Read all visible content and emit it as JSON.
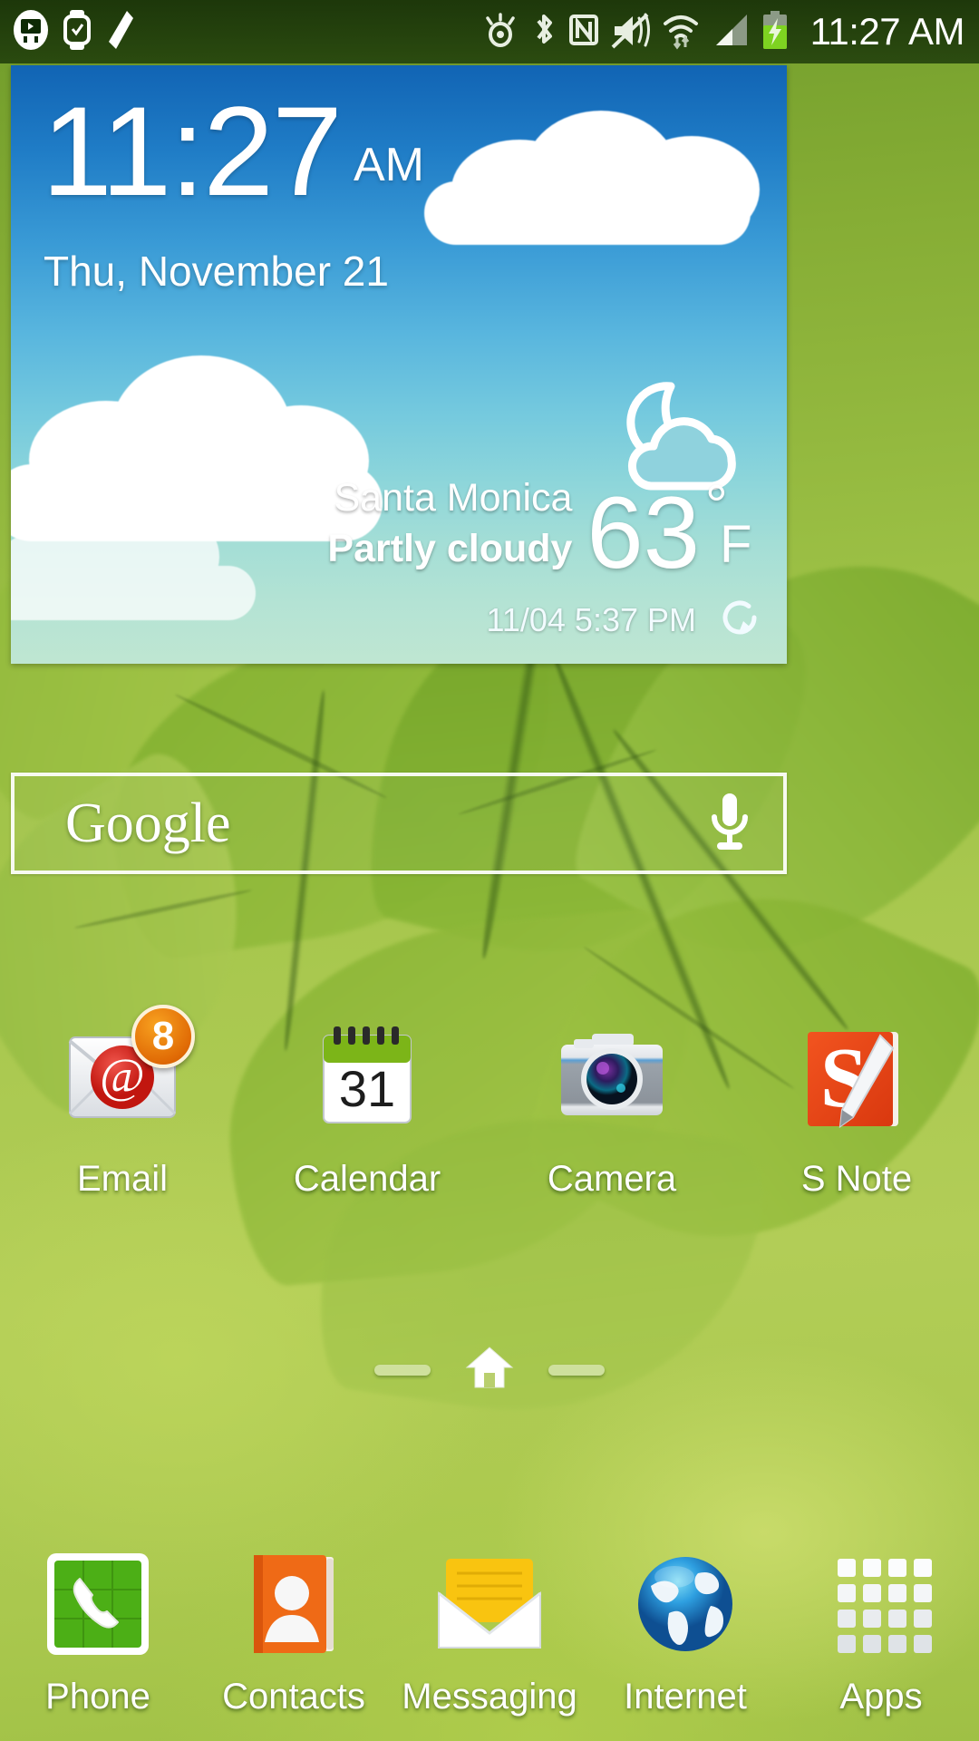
{
  "status_bar": {
    "time": "11:27 AM",
    "left_icons": [
      {
        "name": "smart-remote-icon",
        "label": "Smart Remote"
      },
      {
        "name": "gear-watch-icon",
        "label": "Gear Watch"
      },
      {
        "name": "s-pen-icon",
        "label": "S Pen"
      }
    ],
    "right_icons": [
      {
        "name": "smart-stay-eye-icon",
        "label": "Smart Stay"
      },
      {
        "name": "bluetooth-icon",
        "label": "Bluetooth"
      },
      {
        "name": "nfc-icon",
        "label": "NFC"
      },
      {
        "name": "mute-vibrate-icon",
        "label": "Sound Off / Vibrate"
      },
      {
        "name": "wifi-icon",
        "label": "Wi-Fi"
      },
      {
        "name": "cellular-signal-icon",
        "label": "Signal"
      },
      {
        "name": "battery-charging-icon",
        "label": "Battery Charging"
      }
    ]
  },
  "weather_widget": {
    "time": "11:27",
    "ampm": "AM",
    "date": "Thu, November 21",
    "city": "Santa Monica",
    "condition": "Partly cloudy",
    "condition_icon": "moon-cloud-icon",
    "temperature": "63",
    "degree_symbol": "°",
    "unit": "F",
    "updated": "11/04 5:37 PM",
    "refresh_icon": "refresh-icon",
    "location_icon": "location-crosshair-icon"
  },
  "search": {
    "logo_text": "Google",
    "placeholder": "",
    "mic_icon": "microphone-icon"
  },
  "apps": [
    {
      "label": "Email",
      "icon": "email-icon",
      "badge": "8"
    },
    {
      "label": "Calendar",
      "icon": "calendar-icon",
      "day": "31"
    },
    {
      "label": "Camera",
      "icon": "camera-icon"
    },
    {
      "label": "S Note",
      "icon": "s-note-icon",
      "glyph": "S"
    }
  ],
  "page_indicator": {
    "home_icon": "home-icon",
    "pages": 3,
    "current": 2
  },
  "dock": [
    {
      "label": "Phone",
      "icon": "phone-icon"
    },
    {
      "label": "Contacts",
      "icon": "contacts-icon"
    },
    {
      "label": "Messaging",
      "icon": "messaging-icon"
    },
    {
      "label": "Internet",
      "icon": "internet-globe-icon"
    },
    {
      "label": "Apps",
      "icon": "apps-grid-icon"
    }
  ],
  "colors": {
    "wallpaper_green": "#9ac23f",
    "status_bar": "#0d2a04",
    "widget_sky_top": "#1164b4",
    "widget_sky_bottom": "#bfe6d2",
    "badge_orange": "#e06a05",
    "snote_orange": "#e8441c",
    "phone_green": "#4caf16",
    "contacts_orange": "#ef6a16",
    "messaging_yellow": "#f9c410",
    "internet_blue": "#1878c8"
  }
}
